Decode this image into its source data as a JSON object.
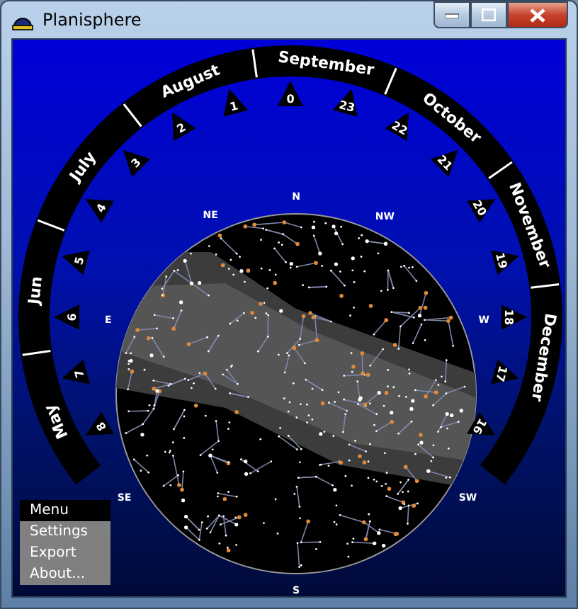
{
  "window": {
    "title": "Planisphere"
  },
  "dial": {
    "months": [
      {
        "label": "May"
      },
      {
        "label": "Jun"
      },
      {
        "label": "July"
      },
      {
        "label": "August"
      },
      {
        "label": "September"
      },
      {
        "label": "October"
      },
      {
        "label": "November"
      },
      {
        "label": "December"
      }
    ],
    "hours": [
      {
        "label": "8"
      },
      {
        "label": "7"
      },
      {
        "label": "6"
      },
      {
        "label": "5"
      },
      {
        "label": "4"
      },
      {
        "label": "3"
      },
      {
        "label": "2"
      },
      {
        "label": "1"
      },
      {
        "label": "0"
      },
      {
        "label": "23"
      },
      {
        "label": "22"
      },
      {
        "label": "21"
      },
      {
        "label": "20"
      },
      {
        "label": "19"
      },
      {
        "label": "18"
      },
      {
        "label": "17"
      },
      {
        "label": "16"
      }
    ],
    "compass": [
      {
        "label": "N"
      },
      {
        "label": "NW"
      },
      {
        "label": "W"
      },
      {
        "label": "SW"
      },
      {
        "label": "S"
      },
      {
        "label": "SE"
      },
      {
        "label": "E"
      },
      {
        "label": "NE"
      }
    ]
  },
  "menu": {
    "items": [
      {
        "label": "Menu",
        "selected": true
      },
      {
        "label": "Settings",
        "selected": false
      },
      {
        "label": "Export",
        "selected": false
      },
      {
        "label": "About...",
        "selected": false
      }
    ]
  }
}
